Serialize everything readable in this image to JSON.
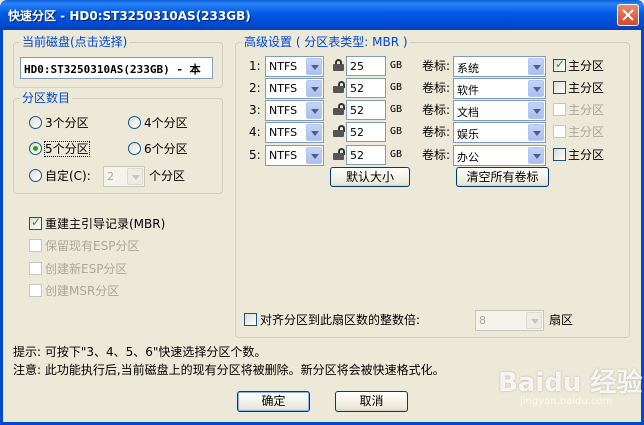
{
  "window": {
    "title": "快速分区 - HD0:ST3250310AS(233GB)"
  },
  "current_disk": {
    "group_title": "当前磁盘(点击选择)",
    "value": "HD0:ST3250310AS(233GB) - 本"
  },
  "partition_count": {
    "group_title": "分区数目",
    "options": [
      "3个分区",
      "4个分区",
      "5个分区",
      "6个分区"
    ],
    "selected": "5个分区",
    "custom_label": "自定(C):",
    "custom_value": "2",
    "custom_suffix": "个分区"
  },
  "checkboxes": {
    "rebuild_mbr": "重建主引导记录(MBR)",
    "keep_esp": "保留现有ESP分区",
    "create_esp": "创建新ESP分区",
    "create_msr": "创建MSR分区"
  },
  "advanced": {
    "group_title": "高级设置 ( 分区表类型: MBR )",
    "unit": "GB",
    "volume_label_text": "卷标:",
    "primary_text": "主分区",
    "rows": [
      {
        "index": "1:",
        "fs": "NTFS",
        "size": "25",
        "label": "系统",
        "primary_checked": true,
        "primary_enabled": true,
        "locked": true
      },
      {
        "index": "2:",
        "fs": "NTFS",
        "size": "52",
        "label": "软件",
        "primary_checked": false,
        "primary_enabled": true,
        "locked": false
      },
      {
        "index": "3:",
        "fs": "NTFS",
        "size": "52",
        "label": "文档",
        "primary_checked": false,
        "primary_enabled": false,
        "locked": false
      },
      {
        "index": "4:",
        "fs": "NTFS",
        "size": "52",
        "label": "娱乐",
        "primary_checked": false,
        "primary_enabled": false,
        "locked": false
      },
      {
        "index": "5:",
        "fs": "NTFS",
        "size": "52",
        "label": "办公",
        "primary_checked": false,
        "primary_enabled": true,
        "locked": false
      }
    ],
    "default_size_button": "默认大小",
    "clear_labels_button": "清空所有卷标",
    "align_label": "对齐分区到此扇区数的整数倍:",
    "align_value": "8",
    "align_unit": "扇区"
  },
  "hints": {
    "line1": "提示: 可按下\"3、4、5、6\"快速选择分区个数。",
    "line2": "注意: 此功能执行后,当前磁盘上的现有分区将被删除。新分区将会被快速格式化。"
  },
  "buttons": {
    "ok": "确定",
    "cancel": "取消"
  },
  "watermark": {
    "text": "Baidu 经验",
    "sub": "jingyan.baidu.com"
  }
}
